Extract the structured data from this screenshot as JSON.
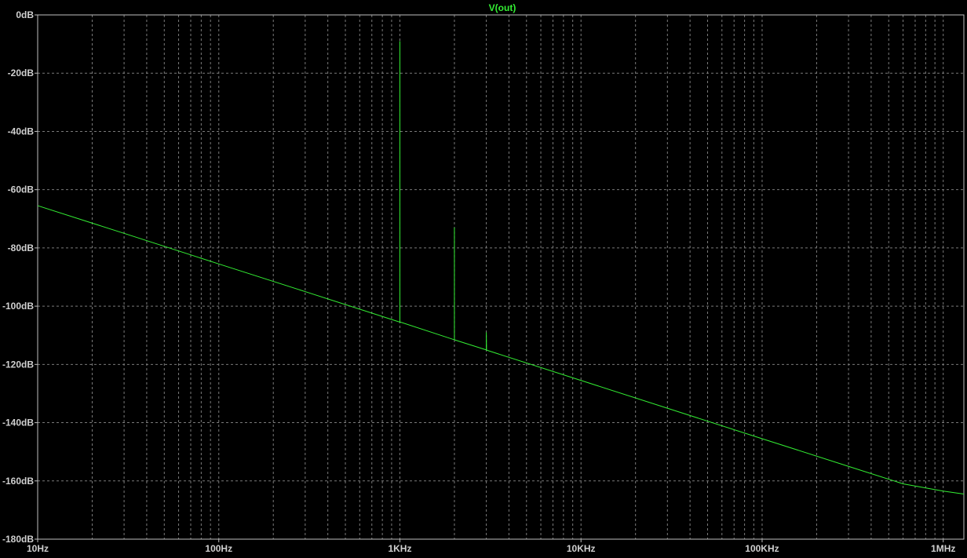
{
  "chart_data": {
    "type": "line",
    "title": "V(out)",
    "x_scale": "log",
    "xlim": [
      10,
      1300000
    ],
    "ylim": [
      -180,
      0
    ],
    "grid": true,
    "x_ticks": [
      {
        "value": 10,
        "label": "10Hz"
      },
      {
        "value": 100,
        "label": "100Hz"
      },
      {
        "value": 1000,
        "label": "1KHz"
      },
      {
        "value": 10000,
        "label": "10KHz"
      },
      {
        "value": 100000,
        "label": "100KHz"
      },
      {
        "value": 1000000,
        "label": "1MHz"
      }
    ],
    "y_ticks": [
      {
        "value": 0,
        "label": "0dB"
      },
      {
        "value": -20,
        "label": "-20dB"
      },
      {
        "value": -40,
        "label": "-40dB"
      },
      {
        "value": -60,
        "label": "-60dB"
      },
      {
        "value": -80,
        "label": "-80dB"
      },
      {
        "value": -100,
        "label": "-100dB"
      },
      {
        "value": -120,
        "label": "-120dB"
      },
      {
        "value": -140,
        "label": "-140dB"
      },
      {
        "value": -160,
        "label": "-160dB"
      },
      {
        "value": -180,
        "label": "-180dB"
      }
    ],
    "series": [
      {
        "name": "V(out)",
        "color": "#33ee33",
        "x": [
          10,
          30,
          100,
          300,
          990,
          1000,
          1000,
          1000,
          1000,
          1010,
          1990,
          2000,
          2000,
          2000,
          2010,
          2990,
          3000,
          3000,
          3010,
          10000,
          100000,
          300000,
          600000,
          1000000,
          1300000
        ],
        "y": [
          -65.5,
          -75,
          -85.5,
          -95,
          -105.4,
          -105.5,
          -57,
          -9,
          -105.5,
          -105.5,
          -111.5,
          -111.5,
          -73,
          -111.5,
          -111.6,
          -115,
          -115,
          -109,
          -115.1,
          -125.5,
          -145.5,
          -155,
          -161,
          -163.5,
          -164.5
        ]
      }
    ]
  }
}
